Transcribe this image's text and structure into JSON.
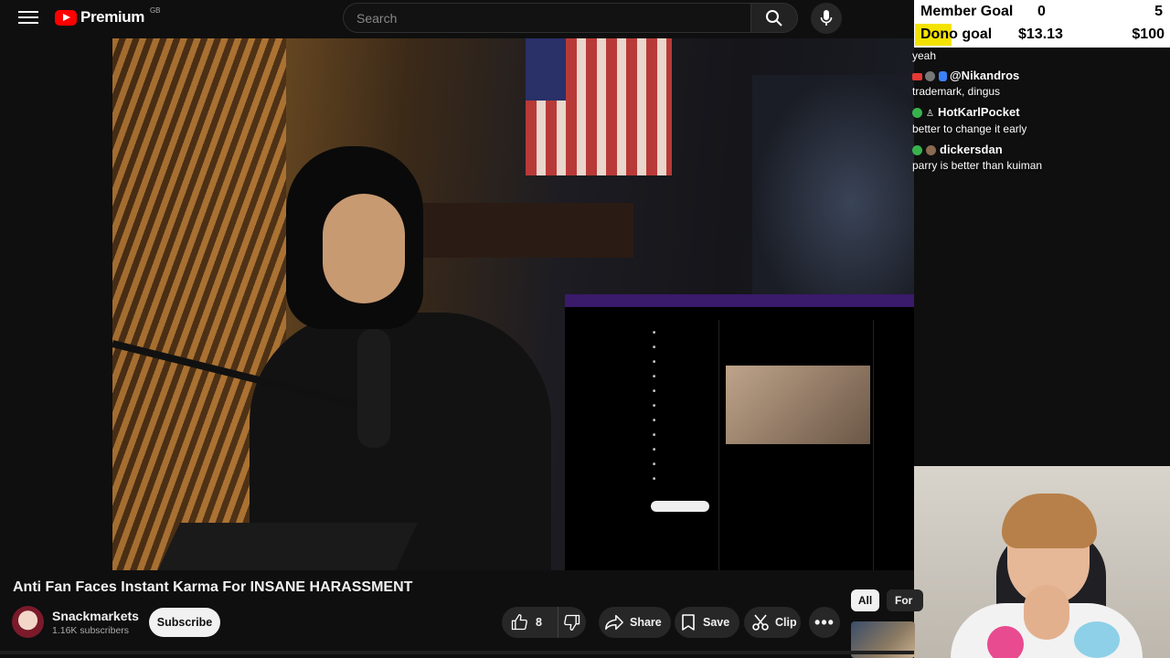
{
  "header": {
    "logo_text": "Premium",
    "country_code": "GB",
    "search_placeholder": "Search"
  },
  "overlay": {
    "member_goal_label": "Member Goal",
    "member_goal_current": "0",
    "member_goal_target": "5",
    "dono_goal_label": "Dono goal",
    "dono_goal_current": "$13.13",
    "dono_goal_target": "$100",
    "highlight_color": "#f4e300",
    "chat": [
      {
        "user": "",
        "message": "yeah"
      },
      {
        "user": "@Nikandros",
        "message": "trademark, dingus"
      },
      {
        "user": "HotKarlPocket",
        "message": "better to change it early"
      },
      {
        "user": "dickersdan",
        "message": "parry is better than kuiman"
      }
    ]
  },
  "video": {
    "title": "Anti Fan Faces Instant Karma For INSANE HARASSMENT",
    "channel_name": "Snackmarkets",
    "subscriber_count": "1.16K subscribers",
    "subscribe_label": "Subscribe",
    "like_count": "8",
    "share_label": "Share",
    "save_label": "Save",
    "clip_label": "Clip"
  },
  "recommendations": {
    "chip_all": "All",
    "chip_for": "For"
  },
  "colors": {
    "background": "#0f0f0f",
    "brand_red": "#ff0000",
    "pill_bg": "#272727"
  }
}
